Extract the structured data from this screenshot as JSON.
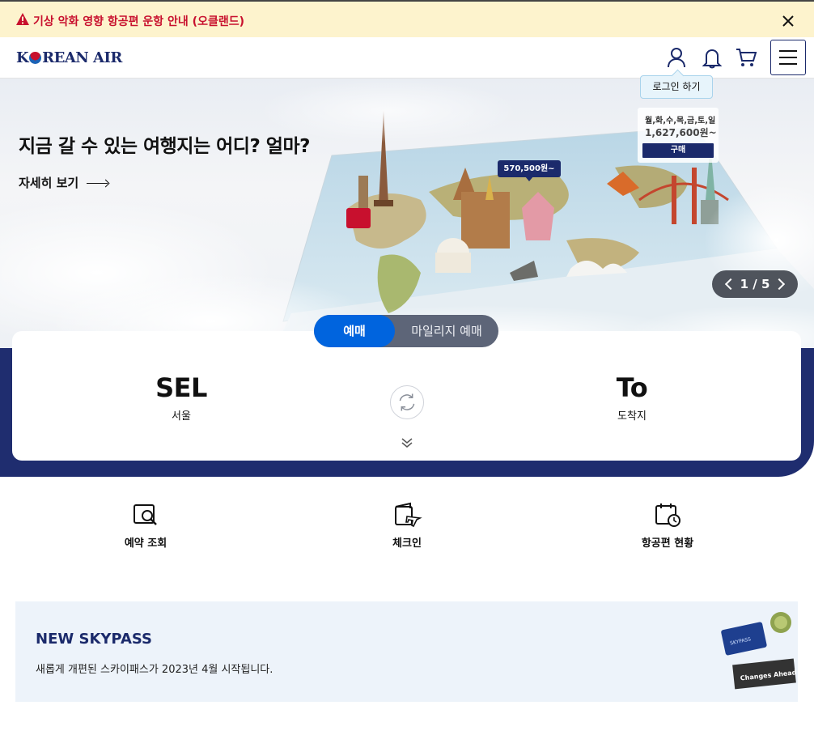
{
  "alert": {
    "text": "기상 악화 영향 항공편 운항 안내 (오클랜드)",
    "icon": "warning-icon",
    "close_icon": "close-icon",
    "color": "#c8102e",
    "background": "#fdf3cd"
  },
  "header": {
    "logo_text_pre": "K",
    "logo_text_post": "REAN AIR",
    "icons": [
      "user-icon",
      "bell-icon",
      "cart-icon",
      "menu-icon"
    ],
    "login_tooltip": "로그인 하기",
    "brand_color": "#1b2a6b"
  },
  "hero": {
    "title": "지금 갈 수 있는 여행지는 어디? 얼마?",
    "more_label": "자세히 보기",
    "price_tag": "570,500원~",
    "ad": {
      "days": "월,화,수,목,금,토,일",
      "price": "1,627,600원~",
      "buy_label": "구매"
    },
    "pager": {
      "current": "1",
      "separator": "/",
      "total": "5"
    }
  },
  "booking": {
    "tabs": [
      {
        "label": "예매",
        "active": true
      },
      {
        "label": "마일리지 예매",
        "active": false
      }
    ],
    "origin": {
      "code": "SEL",
      "city": "서울"
    },
    "destination": {
      "code": "To",
      "city": "도착지"
    },
    "accent": "#0064de",
    "background": "#1f2d6f"
  },
  "quick_menu": [
    {
      "label": "예약 조회",
      "icon": "booking-search-icon"
    },
    {
      "label": "체크인",
      "icon": "checkin-icon"
    },
    {
      "label": "항공편 현황",
      "icon": "flight-status-icon"
    }
  ],
  "banner": {
    "title": "NEW SKYPASS",
    "description": "새롭게 개편된 스카이패스가 2023년 4월 시작됩니다.",
    "card_label": "SKYPASS",
    "sign_label": "Changes Ahead"
  }
}
